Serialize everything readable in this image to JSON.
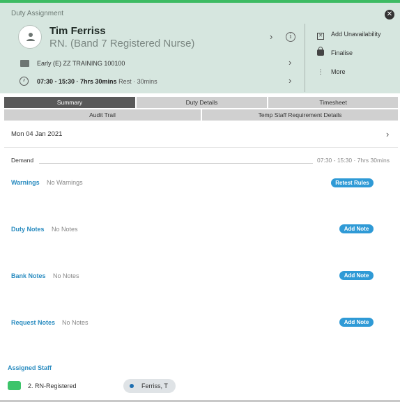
{
  "header": {
    "title": "Duty Assignment",
    "close_icon": "close-icon",
    "name": "Tim Ferriss",
    "role": "RN. (Band 7 Registered Nurse)",
    "shift": "Early (E) ZZ TRAINING 100100",
    "time_bold": "07:30 - 15:30 · 7hrs 30mins",
    "rest": "Rest · 30mins"
  },
  "actions": {
    "add_unavailability": "Add Unavailability",
    "finalise": "Finalise",
    "more": "More"
  },
  "tabs": {
    "row1": [
      "Summary",
      "Duty Details",
      "Timesheet"
    ],
    "row2": [
      "Audit Trail",
      "Temp Staff Requirement Details"
    ],
    "active": "Summary"
  },
  "summary": {
    "date": "Mon 04 Jan 2021",
    "demand_label": "Demand",
    "demand_time": "07:30 - 15:30 · 7hrs 30mins",
    "warnings_label": "Warnings",
    "warnings_value": "No Warnings",
    "retest_rules": "Retest Rules",
    "duty_notes_label": "Duty Notes",
    "duty_notes_value": "No Notes",
    "bank_notes_label": "Bank Notes",
    "bank_notes_value": "No Notes",
    "request_notes_label": "Request Notes",
    "request_notes_value": "No Notes",
    "add_note": "Add Note"
  },
  "assigned": {
    "title": "Assigned Staff",
    "requirement": "2. RN-Registered",
    "staff": "Ferriss, T",
    "chip_color": "#3dc46a"
  },
  "colors": {
    "accent_green": "#3dbb63",
    "header_bg": "#d6e6df",
    "link_blue": "#2a8cc0",
    "button_blue": "#2f9ad6"
  }
}
